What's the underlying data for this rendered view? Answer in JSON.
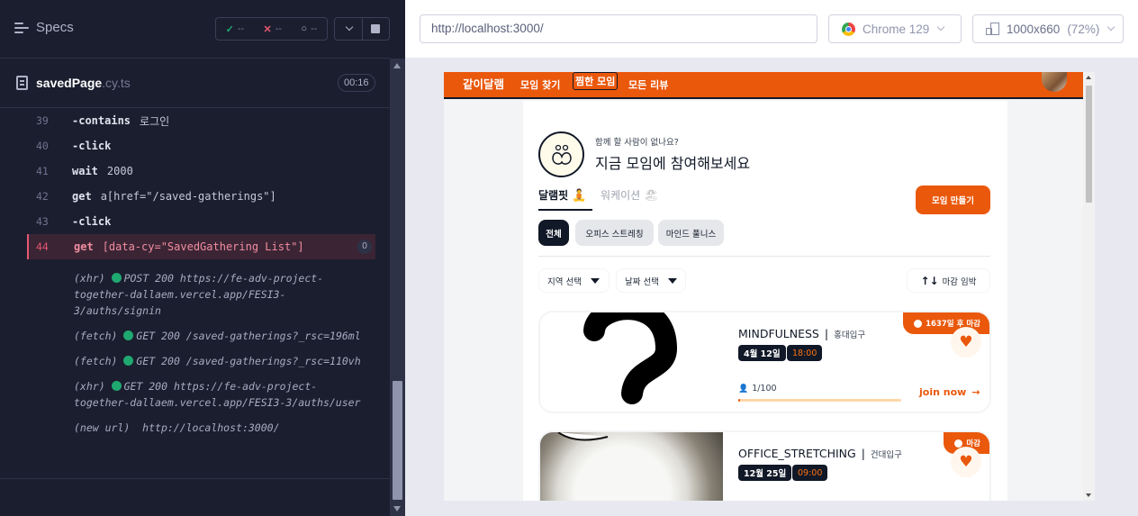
{
  "runner": {
    "specs_label": "Specs",
    "stats": {
      "passed": "--",
      "failed": "--",
      "pending": "--"
    },
    "spec_file": {
      "name": "savedPage",
      "ext": ".cy.ts",
      "duration": "00:16"
    },
    "commands": [
      {
        "num": "39",
        "name": "-contains",
        "message": "로그인"
      },
      {
        "num": "40",
        "name": "-click",
        "message": ""
      },
      {
        "num": "41",
        "name": "wait",
        "message": "2000"
      },
      {
        "num": "42",
        "name": "get",
        "message": "a[href=\"/saved-gatherings\"]"
      },
      {
        "num": "43",
        "name": "-click",
        "message": ""
      },
      {
        "num": "44",
        "name": "get",
        "message": "[data-cy=\"SavedGathering List\"]",
        "count": "0",
        "active": true
      }
    ],
    "requests": [
      {
        "type": "(xhr)",
        "text": "POST 200 https://fe-adv-project-together-dallaem.vercel.app/FESI3-3/auths/signin"
      },
      {
        "type": "(fetch)",
        "text": "GET 200 /saved-gatherings?_rsc=196ml"
      },
      {
        "type": "(fetch)",
        "text": "GET 200 /saved-gatherings?_rsc=110vh"
      },
      {
        "type": "(xhr)",
        "text": "GET 200 https://fe-adv-project-together-dallaem.vercel.app/FESI3-3/auths/user"
      }
    ],
    "new_url": {
      "type": "(new url)",
      "text": "http://localhost:3000/"
    }
  },
  "aut_bar": {
    "url": "http://localhost:3000/",
    "browser": "Chrome 129",
    "viewport": "1000x660",
    "scale": "(72%)"
  },
  "site": {
    "logo": "같이달램",
    "nav": [
      "모임 찾기",
      "찜한 모임",
      "모든 리뷰"
    ],
    "hero_subtitle": "함께 할 사람이 없나요?",
    "hero_title": "지금 모임에 참여해보세요",
    "tabs": [
      {
        "label": "달램핏",
        "emoji": "🧘"
      },
      {
        "label": "워케이션",
        "emoji": "🏖"
      }
    ],
    "create_button": "모임 만들기",
    "chips": [
      "전체",
      "오피스 스트레칭",
      "마인드 풀니스"
    ],
    "filters": {
      "region": "지역 선택",
      "date": "날짜 선택",
      "sort": "마감 임박"
    },
    "cards": [
      {
        "deadline": "1637일 후 마감",
        "type": "MINDFULNESS",
        "location": "홍대입구",
        "date": "4월 12일",
        "time": "18:00",
        "attendance": "1/100",
        "progress": 0.01,
        "join": "join now"
      },
      {
        "deadline": "마감",
        "type": "OFFICE_STRETCHING",
        "location": "건대입구",
        "date": "12월 25일",
        "time": "09:00"
      }
    ]
  },
  "colors": {
    "brand_orange": "#ea580c",
    "runner_bg": "#1b1e2e",
    "pass_green": "#1fa971",
    "fail_red": "#e45770"
  }
}
